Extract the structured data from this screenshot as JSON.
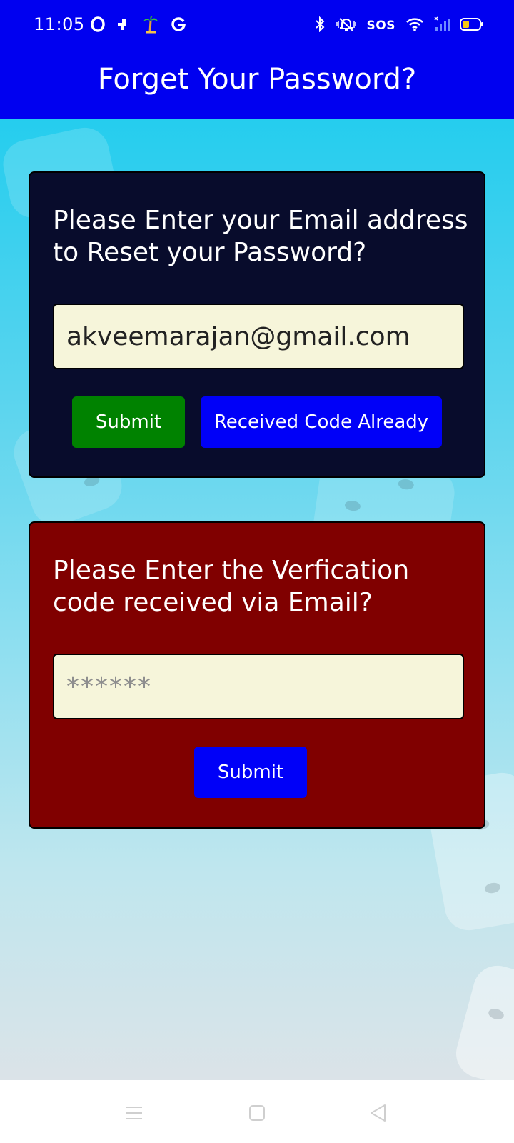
{
  "status_bar": {
    "time": "11:05",
    "left_icons": [
      "opera-icon",
      "notification-app-icon",
      "palm-tree-icon",
      "google-icon"
    ],
    "sos_label": "SOS",
    "right_icons": [
      "bluetooth-icon",
      "vibrate-icon",
      "wifi-icon",
      "signal-icon",
      "battery-icon"
    ]
  },
  "header": {
    "title": "Forget Your Password?",
    "background_color": "#0000f0"
  },
  "email_card": {
    "heading": "Please Enter your Email address to Reset your Password?",
    "email_value": "akveemarajan@gmail.com",
    "submit_label": "Submit",
    "received_label": "Received Code Already",
    "background_color": "#080c2c"
  },
  "code_card": {
    "heading": "Please Enter the Verfication code received via Email?",
    "code_placeholder": "******",
    "code_value": "",
    "submit_label": "Submit",
    "background_color": "#800000"
  },
  "colors": {
    "submit_green": "#008200",
    "button_blue": "#0000f8",
    "input_background": "#f6f5da"
  },
  "nav_bar": {
    "icons": [
      "menu-icon",
      "home-icon",
      "back-icon"
    ]
  }
}
